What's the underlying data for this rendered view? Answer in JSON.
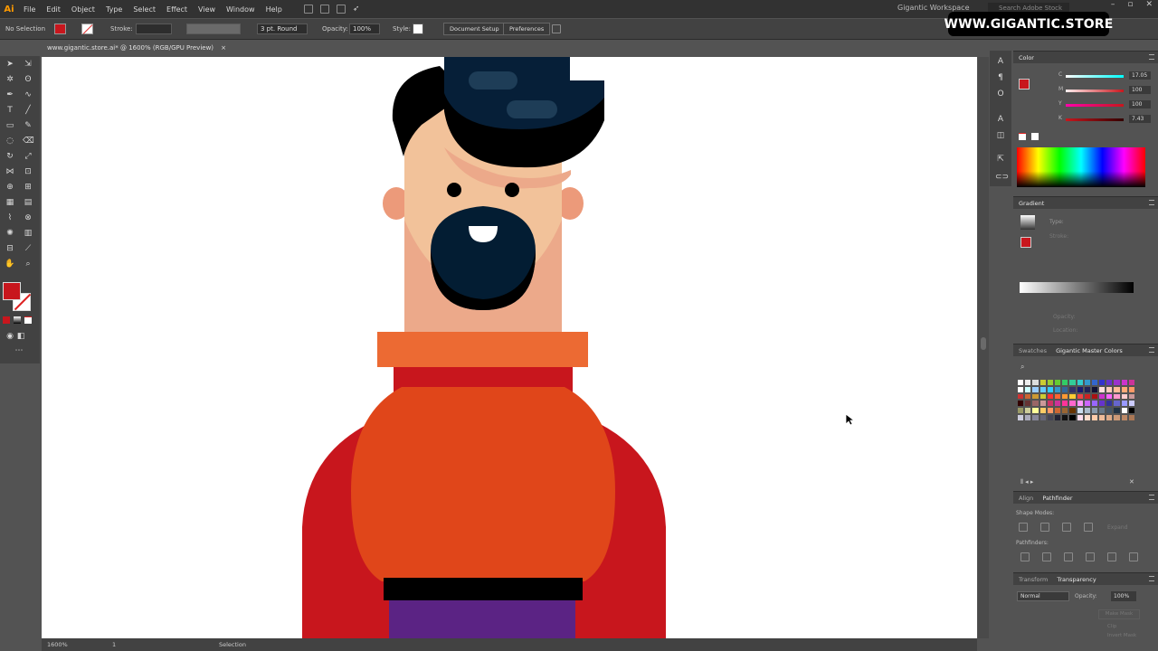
{
  "app": {
    "logo": "Ai",
    "accent": "#ff9a00"
  },
  "menu": {
    "items": [
      "File",
      "Edit",
      "Object",
      "Type",
      "Select",
      "Effect",
      "View",
      "Window",
      "Help"
    ]
  },
  "workspace": {
    "label": "Gigantic Workspace",
    "search_placeholder": "Search Adobe Stock"
  },
  "watermark": {
    "text": "WWW.GIGANTIC.STORE"
  },
  "controlbar": {
    "selection": "No Selection",
    "stroke_label": "Stroke:",
    "brush": "3 pt. Round",
    "opacity_label": "Opacity:",
    "opacity_value": "100%",
    "style_label": "Style:",
    "document_setup": "Document Setup",
    "preferences": "Preferences",
    "fill_color": "#c8161d"
  },
  "document": {
    "tab_title": "www.gigantic.store.ai* @ 1600% (RGB/GPU Preview)",
    "close": "×"
  },
  "color_panel": {
    "title": "Color",
    "channels": [
      {
        "name": "C",
        "value": "17.05"
      },
      {
        "name": "M",
        "value": "100"
      },
      {
        "name": "Y",
        "value": "100"
      },
      {
        "name": "K",
        "value": "7.43"
      }
    ]
  },
  "gradient_panel": {
    "title": "Gradient",
    "type_label": "Type:",
    "stroke_label": "Stroke:",
    "opacity_label": "Opacity:",
    "location_label": "Location:"
  },
  "swatches_panel": {
    "tab1": "Swatches",
    "tab2": "Gigantic Master Colors"
  },
  "pathfinder_panel": {
    "tab1": "Align",
    "tab2": "Pathfinder",
    "shape_modes": "Shape Modes:",
    "pathfinders": "Pathfinders:",
    "expand": "Expand"
  },
  "transparency_panel": {
    "tab1": "Transform",
    "tab2": "Transparency",
    "blend_mode": "Normal",
    "opacity_label": "Opacity:",
    "opacity_value": "100%",
    "make_mask": "Make Mask",
    "clip": "Clip",
    "invert_mask": "Invert Mask"
  },
  "statusbar": {
    "zoom": "1600%",
    "artboard": "1",
    "tool": "Selection"
  },
  "artwork_colors": {
    "hair": "#000000",
    "hair_top": "#061f38",
    "skin": "#f2c29a",
    "skin_shadow": "#eca98a",
    "ear": "#ec9a7a",
    "beard": "#031d33",
    "collar": "#ec6a33",
    "neckband": "#c8161d",
    "body": "#e0461a",
    "sleeves": "#c8161d",
    "belt": "#000000",
    "pants": "#5b2384"
  }
}
